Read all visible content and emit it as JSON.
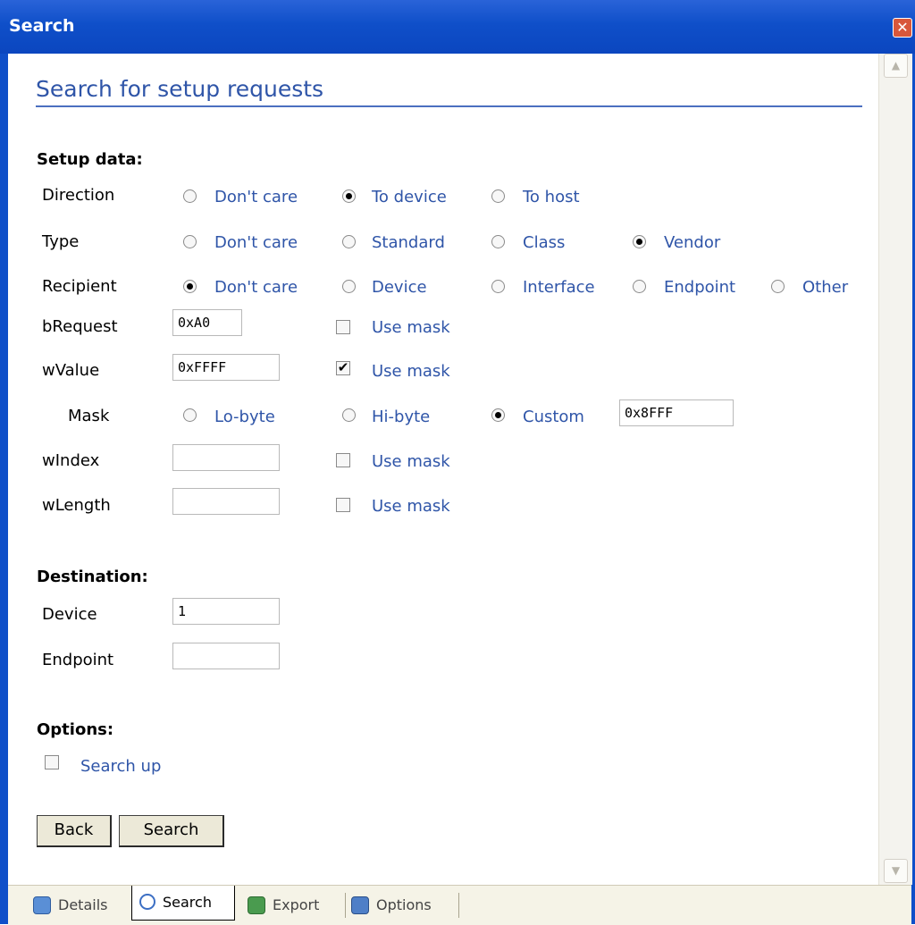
{
  "window": {
    "title": "Search",
    "close_icon": "close-icon"
  },
  "heading": "Search for setup requests",
  "setup": {
    "section_title": "Setup data:",
    "direction": {
      "label": "Direction",
      "options": [
        "Don't care",
        "To device",
        "To host"
      ],
      "selected": "To device"
    },
    "type": {
      "label": "Type",
      "options": [
        "Don't care",
        "Standard",
        "Class",
        "Vendor"
      ],
      "selected": "Vendor"
    },
    "recipient": {
      "label": "Recipient",
      "options": [
        "Don't care",
        "Device",
        "Interface",
        "Endpoint",
        "Other"
      ],
      "selected": "Don't care"
    },
    "brequest": {
      "label": "bRequest",
      "value": "0xA0",
      "mask_label": "Use mask",
      "mask_checked": false
    },
    "wvalue": {
      "label": "wValue",
      "value": "0xFFFF",
      "mask_label": "Use mask",
      "mask_checked": true
    },
    "mask": {
      "label": "Mask",
      "options": [
        "Lo-byte",
        "Hi-byte",
        "Custom"
      ],
      "selected": "Custom",
      "custom_value": "0x8FFF"
    },
    "windex": {
      "label": "wIndex",
      "value": "",
      "mask_label": "Use mask",
      "mask_checked": false
    },
    "wlength": {
      "label": "wLength",
      "value": "",
      "mask_label": "Use mask",
      "mask_checked": false
    }
  },
  "destination": {
    "section_title": "Destination:",
    "device": {
      "label": "Device",
      "value": "1"
    },
    "endpoint": {
      "label": "Endpoint",
      "value": ""
    }
  },
  "options": {
    "section_title": "Options:",
    "search_up_label": "Search up",
    "search_up_checked": false
  },
  "buttons": {
    "back": "Back",
    "search": "Search"
  },
  "tabs": [
    {
      "label": "Details",
      "icon": "details-icon"
    },
    {
      "label": "Search",
      "icon": "search-icon",
      "active": true
    },
    {
      "label": "Export",
      "icon": "export-icon"
    },
    {
      "label": "Options",
      "icon": "options-icon"
    }
  ]
}
